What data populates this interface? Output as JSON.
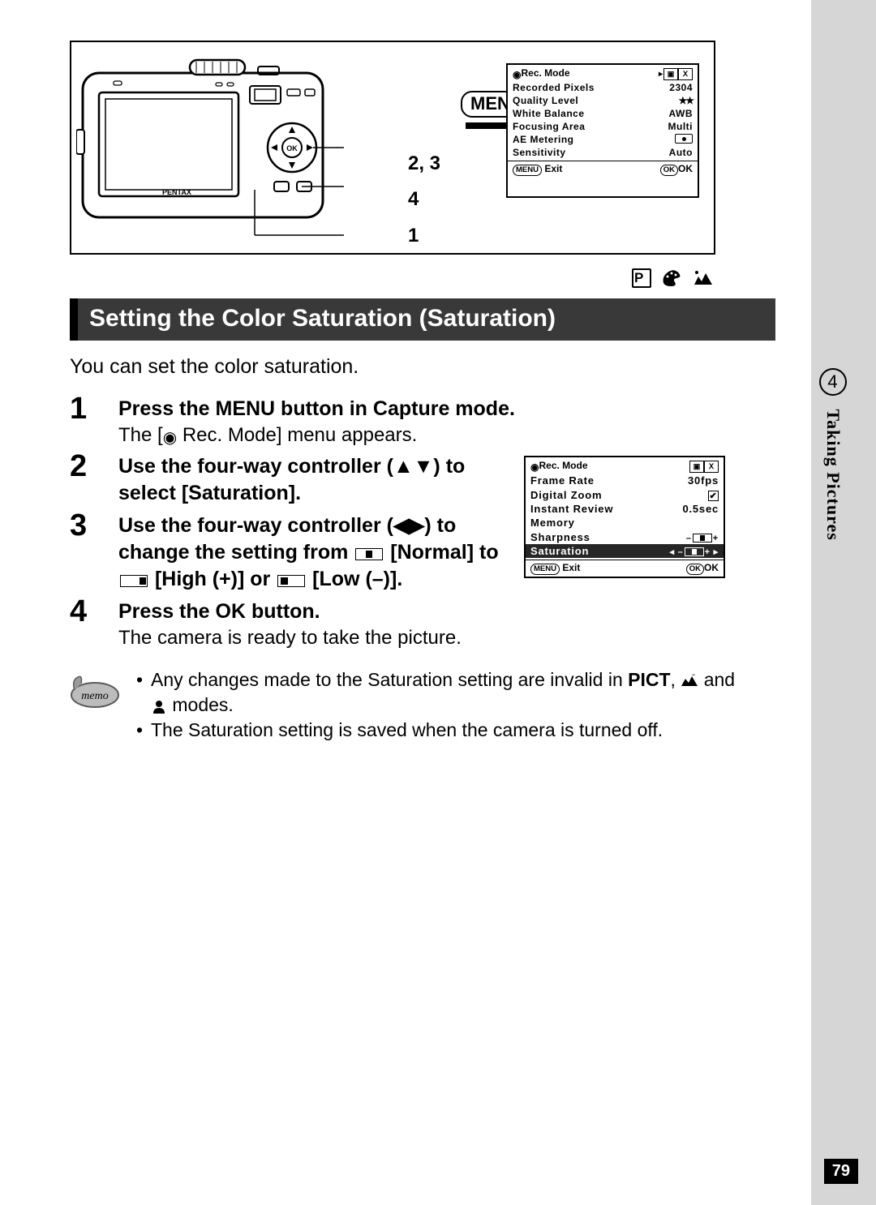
{
  "diagram": {
    "menu_label": "MENU",
    "step_labels": [
      "2, 3",
      "4",
      "1"
    ]
  },
  "lcd_top": {
    "title": "Rec. Mode",
    "rows": [
      {
        "label": "Recorded Pixels",
        "value": "2304"
      },
      {
        "label": "Quality Level",
        "value": "★★"
      },
      {
        "label": "White Balance",
        "value": "AWB"
      },
      {
        "label": "Focusing Area",
        "value": "Multi"
      },
      {
        "label": "AE Metering",
        "value": ""
      },
      {
        "label": "Sensitivity",
        "value": "Auto"
      }
    ],
    "footer_left_chip": "MENU",
    "footer_left": "Exit",
    "footer_right_chip": "OK",
    "footer_right": "OK"
  },
  "mode_icons": {
    "p": "P"
  },
  "heading": "Setting the Color Saturation (Saturation)",
  "intro": "You can set the color saturation.",
  "steps": [
    {
      "num": "1",
      "title": "Press the MENU button in Capture mode.",
      "desc_pre": "The [",
      "desc_post": " Rec. Mode] menu appears."
    },
    {
      "num": "2",
      "title": "Use the four-way controller (▲▼) to select [Saturation]."
    },
    {
      "num": "3",
      "title_pre": "Use the four-way controller (◀▶) to change the setting from ",
      "normal": " [Normal] to ",
      "high": " [High (+)] or ",
      "low": " [Low (–)]."
    },
    {
      "num": "4",
      "title": "Press the OK button.",
      "desc": "The camera is ready to take the picture."
    }
  ],
  "lcd_side": {
    "title": "Rec. Mode",
    "rows": [
      {
        "label": "Frame Rate",
        "value": "30fps"
      },
      {
        "label": "Digital Zoom",
        "value": "check"
      },
      {
        "label": "Instant Review",
        "value": "0.5sec"
      },
      {
        "label": "Memory",
        "value": ""
      },
      {
        "label": "Sharpness",
        "value": "slider"
      },
      {
        "label": "Saturation",
        "value": "slider-hl",
        "highlight": true
      }
    ],
    "footer_left_chip": "MENU",
    "footer_left": "Exit",
    "footer_right_chip": "OK",
    "footer_right": "OK"
  },
  "memo": {
    "label": "memo",
    "items": [
      {
        "pre": "Any changes made to the Saturation setting are invalid in ",
        "pict": "PICT",
        "mid": ", ",
        "post": " and ",
        "tail": " modes."
      },
      {
        "text": "The Saturation setting is saved when the camera is turned off."
      }
    ]
  },
  "tab": {
    "num": "4",
    "label": "Taking Pictures"
  },
  "page_number": "79"
}
